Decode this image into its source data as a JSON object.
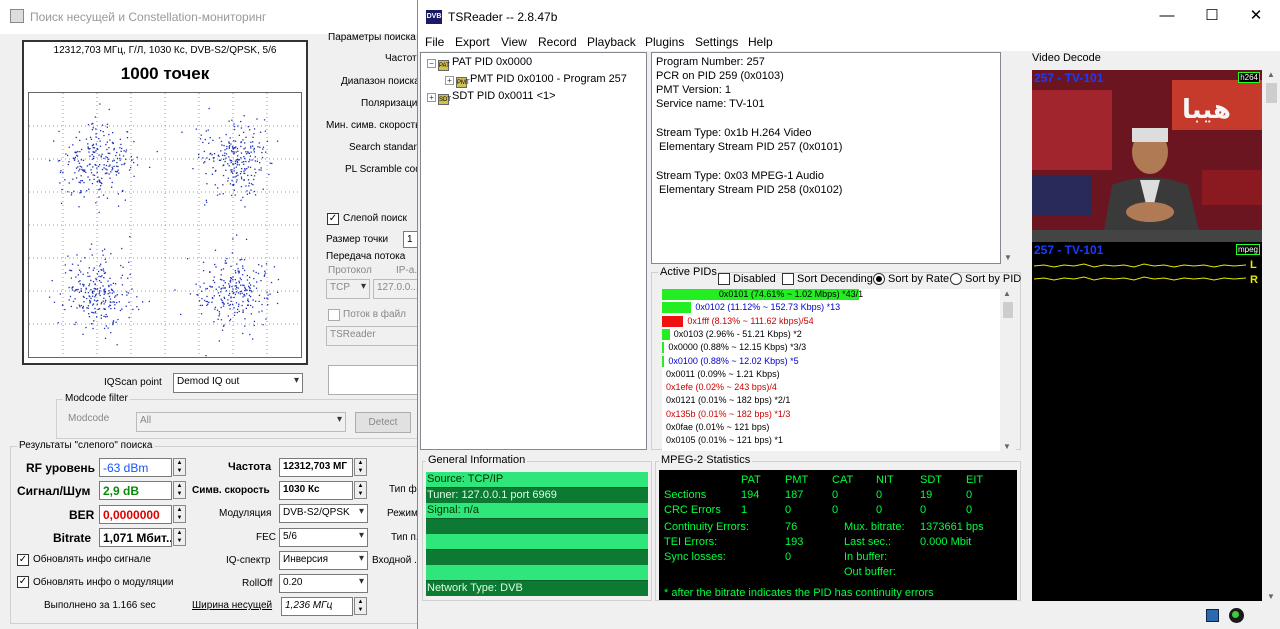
{
  "bg_window": {
    "title": "Поиск несущей и Constellation-мониторинг",
    "constellation": {
      "header": "12312,703 МГц, Г/Л, 1030 Кс, DVB-S2/QPSK, 5/6",
      "points_label": "1000 точек"
    },
    "right_labels": [
      "Параметры поиска",
      "Частота",
      "Диапазон поиска",
      "Поляризация",
      "Мин. симв. скорость",
      "Search standard",
      "PL Scramble code"
    ],
    "blind_search": {
      "label": "Слепой поиск",
      "checked": true
    },
    "point_size": {
      "label": "Размер точки",
      "value": "1"
    },
    "stream_transfer": {
      "title": "Передача потока",
      "protocol_label": "Протокол",
      "ip_label": "IP-а...",
      "protocol_value": "TCP",
      "ip_value": "127.0.0...",
      "to_file_label": "Поток в файл",
      "app_value": "TSReader"
    },
    "iqscan": {
      "label": "IQScan point",
      "value": "Demod IQ out"
    },
    "modcode_filter": {
      "title": "Modcode filter",
      "label": "Modcode",
      "value": "All",
      "detect_button": "Detect"
    },
    "results": {
      "title": "Результаты \"слепого\" поиска",
      "rf_label": "RF уровень",
      "rf_value": "-63 dBm",
      "snr_label": "Сигнал/Шум",
      "snr_value": "2,9 dB",
      "ber_label": "BER",
      "ber_value": "0,0000000",
      "bitrate_label": "Bitrate",
      "bitrate_value": "1,071 Мбит...",
      "freq_label": "Частота",
      "freq_value": "12312,703 МГ",
      "sr_label": "Симв. скорость",
      "sr_value": "1030 Кс",
      "mod_label": "Модуляция",
      "mod_value": "DVB-S2/QPSK",
      "fec_label": "FEC",
      "fec_value": "5/6",
      "iq_label": "IQ-спектр",
      "iq_value": "Инверсия",
      "rolloff_label": "RollOff",
      "rolloff_value": "0.20",
      "cut_labels": [
        "Тип ф...",
        "Режим...",
        "Тип п...",
        "Входной ..."
      ],
      "update_signal": "Обновлять инфо сигнале",
      "update_mod": "Обновлять инфо о модуляции",
      "done": "Выполнено за 1.166 sec",
      "bw_label": "Ширина несущей",
      "bw_value": "1,236 МГц"
    }
  },
  "tsreader": {
    "title": "TSReader -- 2.8.47b",
    "logo": "DVB",
    "window_buttons": [
      "—",
      "☐",
      "✕"
    ],
    "menu": [
      "File",
      "Export",
      "View",
      "Record",
      "Playback",
      "Plugins",
      "Settings",
      "Help"
    ],
    "tree": [
      {
        "label": "PAT PID 0x0000",
        "icon": "PAT",
        "exp": "−"
      },
      {
        "label": "PMT PID 0x0100 - Program 257",
        "icon": "PMT",
        "exp": "+"
      },
      {
        "label": "SDT PID 0x0011 <1>",
        "icon": "SDT",
        "exp": "+"
      }
    ],
    "info_lines": [
      "Program Number: 257",
      "PCR on PID 259 (0x0103)",
      "PMT Version: 1",
      "Service name: TV-101",
      "",
      "Stream Type: 0x1b H.264 Video",
      " Elementary Stream PID 257 (0x0101)",
      "",
      "Stream Type: 0x03 MPEG-1 Audio",
      " Elementary Stream PID 258 (0x0102)"
    ],
    "active_pids": {
      "title": "Active PIDs",
      "options": [
        {
          "label": "Disabled",
          "type": "check",
          "on": false
        },
        {
          "label": "Sort Decending",
          "type": "check",
          "on": false
        },
        {
          "label": "Sort by Rate",
          "type": "radio",
          "on": true
        },
        {
          "label": "Sort by PID",
          "type": "radio",
          "on": false
        }
      ],
      "rows": [
        {
          "text": "0x0101 (74.61% ~ 1.02 Mbps) *43/1",
          "bar": 0.765,
          "bar_color": "#22ee22",
          "text_color": "#000",
          "center": true
        },
        {
          "text": "0x0102 (11.12% ~ 152.73 Kbps) *13",
          "bar": 0.114,
          "bar_color": "#22ee22",
          "text_color": "#0000cc"
        },
        {
          "text": "0x1fff (8.13% ~ 111.62 kbps)/54",
          "bar": 0.083,
          "bar_color": "#ee1111",
          "text_color": "#cc0000"
        },
        {
          "text": "0x0103 (2.96% - 51.21 Kbps) *2",
          "bar": 0.03,
          "bar_color": "#22ee22",
          "text_color": "#000"
        },
        {
          "text": "0x0000 (0.88% ~ 12.15 Kbps) *3/3",
          "bar": 0.009,
          "bar_color": "#22ee22",
          "text_color": "#000"
        },
        {
          "text": "0x0100 (0.88% ~ 12.02 Kbps) *5",
          "bar": 0.009,
          "bar_color": "#22ee22",
          "text_color": "#0000cc"
        },
        {
          "text": "0x0011 (0.09% ~ 1.21 Kbps)",
          "bar": 0,
          "bar_color": "#22ee22",
          "text_color": "#000"
        },
        {
          "text": "0x1efe (0.02% ~ 243 bps)/4",
          "bar": 0,
          "bar_color": "#22ee22",
          "text_color": "#cc0000"
        },
        {
          "text": "0x0121 (0.01% ~ 182 bps) *2/1",
          "bar": 0,
          "bar_color": "#22ee22",
          "text_color": "#000"
        },
        {
          "text": "0x135b (0.01% ~ 182 bps) *1/3",
          "bar": 0,
          "bar_color": "#22ee22",
          "text_color": "#cc0000"
        },
        {
          "text": "0x0fae (0.01% ~ 121 bps)",
          "bar": 0,
          "bar_color": "#22ee22",
          "text_color": "#000"
        },
        {
          "text": "0x0105 (0.01% ~ 121 bps) *1",
          "bar": 0,
          "bar_color": "#22ee22",
          "text_color": "#000"
        }
      ]
    },
    "general_info": {
      "title": "General Information",
      "rows": [
        "Source: TCP/IP",
        "Tuner: 127.0.0.1 port 6969",
        "Signal: n/a",
        "",
        "",
        "",
        "",
        "Network Type: DVB"
      ]
    },
    "mpeg2": {
      "title": "MPEG-2 Statistics",
      "headers": [
        "PAT",
        "PMT",
        "CAT",
        "NIT",
        "SDT",
        "EIT"
      ],
      "sections_label": "Sections",
      "sections": [
        "194",
        "187",
        "0",
        "0",
        "19",
        "0"
      ],
      "crc_label": "CRC Errors",
      "crc": [
        "1",
        "0",
        "0",
        "0",
        "0",
        "0"
      ],
      "cont_label": "Continuity Errors:",
      "cont_value": "76",
      "tei_label": "TEI Errors:",
      "tei_value": "193",
      "sync_label": "Sync losses:",
      "sync_value": "0",
      "mux_label": "Mux. bitrate:",
      "mux_value": "1373661 bps",
      "last_label": "Last sec.:",
      "last_value": "0.000 Mbit",
      "inbuf_label": "In buffer:",
      "outbuf_label": "Out buffer:",
      "note": "* after the bitrate indicates the PID has continuity errors"
    },
    "video_decode": {
      "title": "Video Decode",
      "overlay": "257 - TV-101",
      "codec_badge": "h264",
      "audio_overlay": "257 - TV-101",
      "audio_badge": "mpeg",
      "ch_left": "L",
      "ch_right": "R"
    }
  }
}
